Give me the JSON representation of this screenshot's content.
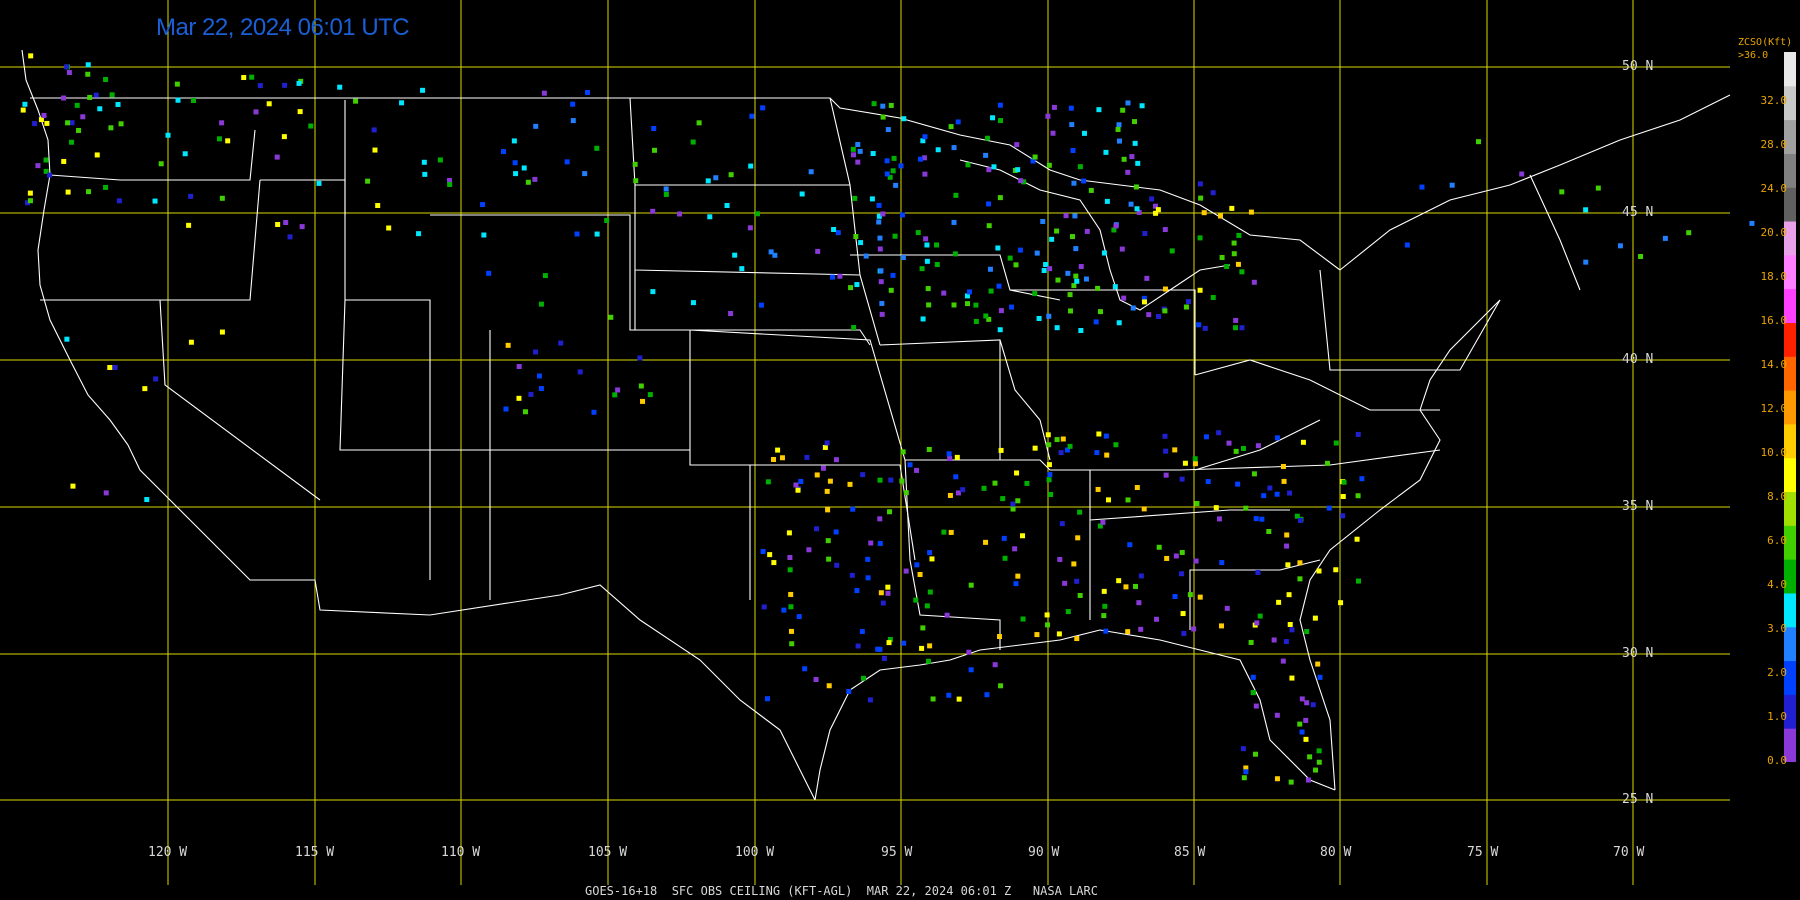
{
  "title": "Mar 22, 2024 06:01 UTC",
  "footer": "GOES-16+18  SFC OBS CEILING (KFT-AGL)  MAR 22, 2024 06:01 Z   NASA LARC",
  "colors": {
    "grid": "#d8d800",
    "border": "#ffffff",
    "title": "#1a5fd6",
    "legend_text": "#e8a400"
  },
  "lat_labels": [
    "50 N",
    "45 N",
    "40 N",
    "35 N",
    "30 N",
    "25 N"
  ],
  "lon_labels": [
    "120 W",
    "115 W",
    "110 W",
    "105 W",
    "100 W",
    "95 W",
    "90 W",
    "85 W",
    "80 W",
    "75 W",
    "70 W"
  ],
  "colorbar": {
    "title": [
      "ZCSO(Kft)",
      ">36.0"
    ],
    "labels": [
      "32.0",
      "28.0",
      "24.0",
      "20.0",
      "18.0",
      "16.0",
      "14.0",
      "12.0",
      "10.0",
      "8.0",
      "6.0",
      "4.0",
      "3.0",
      "2.0",
      "1.0",
      "0.0"
    ],
    "colors": [
      "#8a38d8",
      "#2020d0",
      "#0040ff",
      "#2080ff",
      "#00e8ff",
      "#00b000",
      "#40d000",
      "#a0e000",
      "#ffff00",
      "#ffcc00",
      "#ff9900",
      "#ff6600",
      "#ff2000",
      "#ff40ff",
      "#ff80ff",
      "#e8a0e8",
      "#606060",
      "#808080",
      "#a0a0a0",
      "#c8c8c8",
      "#e8e8e8"
    ]
  }
}
